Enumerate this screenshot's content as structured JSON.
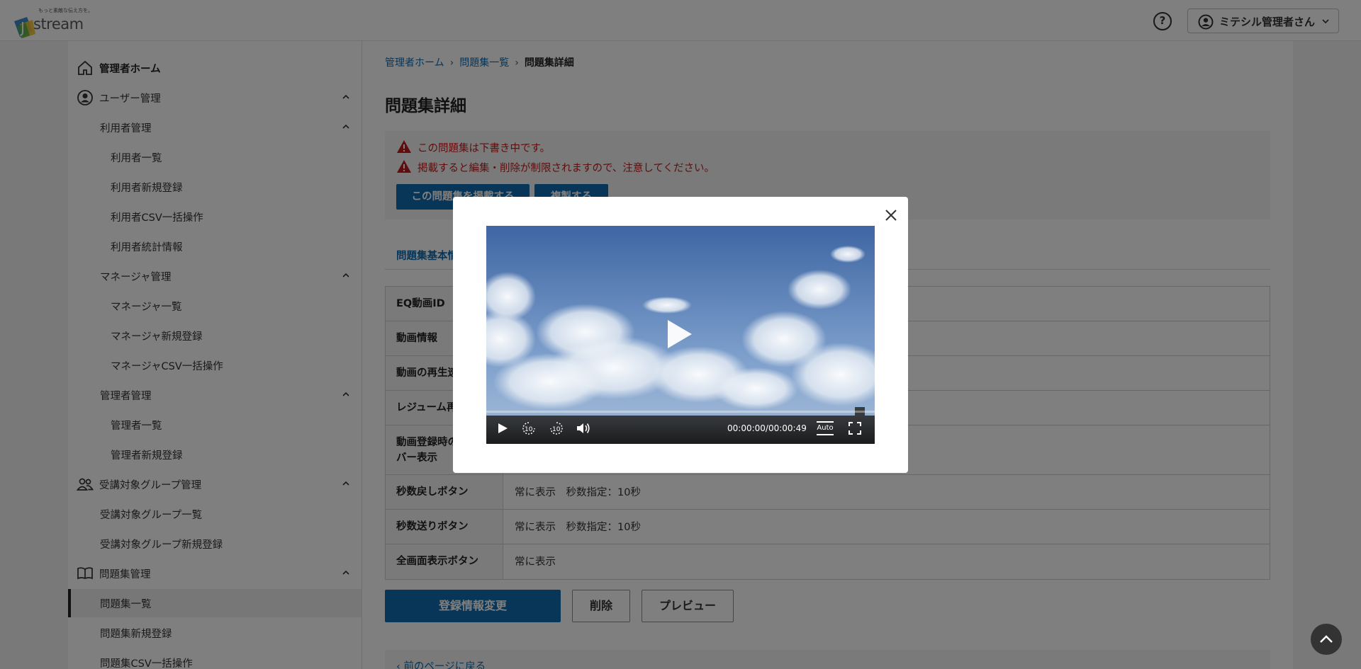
{
  "header": {
    "logo_tagline": "もっと素敵な伝え方を。",
    "logo_text": "stream",
    "logo_letter": "J",
    "help_label": "?",
    "user_name": "ミテシル管理者さん"
  },
  "sidebar": {
    "items": [
      {
        "label": "管理者ホーム"
      },
      {
        "label": "ユーザー管理"
      },
      {
        "label": "利用者管理"
      },
      {
        "label": "利用者一覧"
      },
      {
        "label": "利用者新規登録"
      },
      {
        "label": "利用者CSV一括操作"
      },
      {
        "label": "利用者統計情報"
      },
      {
        "label": "マネージャ管理"
      },
      {
        "label": "マネージャ一覧"
      },
      {
        "label": "マネージャ新規登録"
      },
      {
        "label": "マネージャCSV一括操作"
      },
      {
        "label": "管理者管理"
      },
      {
        "label": "管理者一覧"
      },
      {
        "label": "管理者新規登録"
      },
      {
        "label": "受講対象グループ管理"
      },
      {
        "label": "受講対象グループ一覧"
      },
      {
        "label": "受講対象グループ新規登録"
      },
      {
        "label": "問題集管理"
      },
      {
        "label": "問題集一覧"
      },
      {
        "label": "問題集新規登録"
      },
      {
        "label": "問題集CSV一括操作"
      }
    ]
  },
  "breadcrumb": {
    "home": "管理者ホーム",
    "list": "問題集一覧",
    "current": "問題集詳細"
  },
  "page_title": "問題集詳細",
  "warnings": [
    "この問題集は下書き中です。",
    "掲載すると編集・削除が制限されますので、注意してください。"
  ],
  "actions": {
    "publish": "この問題集を掲載する",
    "copy": "複製する"
  },
  "tabs": {
    "basic_info": "問題集基本情報"
  },
  "info_table": [
    {
      "label": "EQ動画ID",
      "value": ""
    },
    {
      "label": "動画情報",
      "value": ""
    },
    {
      "label": "動画の再生速度",
      "value": ""
    },
    {
      "label": "レジューム再生",
      "value": ""
    },
    {
      "label": "動画登録時のシークバー表示",
      "value": ""
    },
    {
      "label": "秒数戻しボタン",
      "value": "常に表示　秒数指定：10秒"
    },
    {
      "label": "秒数送りボタン",
      "value": "常に表示　秒数指定：10秒"
    },
    {
      "label": "全画面表示ボタン",
      "value": "常に表示"
    }
  ],
  "buttons": {
    "edit": "登録情報変更",
    "delete": "削除",
    "preview": "プレビュー"
  },
  "back_link": "前のページに戻る",
  "video_player": {
    "time": "00:00:00/00:00:49",
    "quality": "Auto",
    "skip_seconds": "10",
    "progress": 0
  },
  "colors": {
    "accent": "#0f6cb3",
    "warning": "#c41a1a",
    "overlay": "rgba(0,0,0,0.5)"
  }
}
